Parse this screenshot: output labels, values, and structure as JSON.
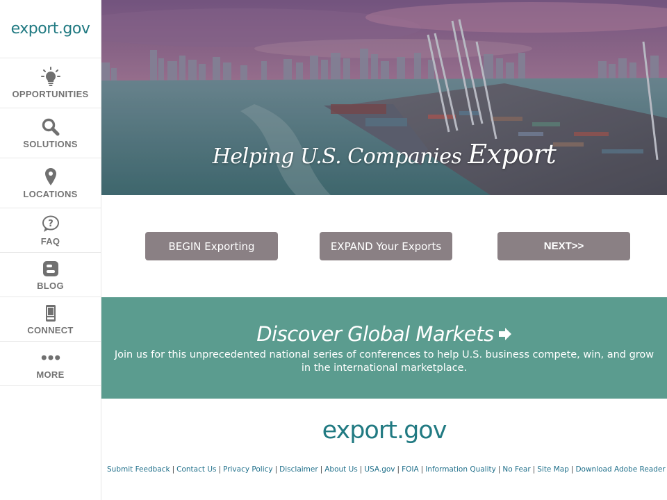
{
  "sidebar": {
    "logo": "export.gov",
    "items": [
      {
        "label": "OPPORTUNITIES",
        "icon": "lightbulb-icon"
      },
      {
        "label": "SOLUTIONS",
        "icon": "search-icon"
      },
      {
        "label": "LOCATIONS",
        "icon": "map-pin-icon"
      },
      {
        "label": "FAQ",
        "icon": "question-bubble-icon"
      },
      {
        "label": "BLOG",
        "icon": "blogger-icon"
      },
      {
        "label": "CONNECT",
        "icon": "mobile-phone-icon"
      },
      {
        "label": "MORE",
        "icon": "more-dots-icon"
      }
    ]
  },
  "hero": {
    "title_prefix": "Helping U.S. Companies ",
    "title_emphasis": "Export"
  },
  "buttons": {
    "begin": "BEGIN Exporting",
    "expand": "EXPAND Your Exports",
    "next": "NEXT>>"
  },
  "banner": {
    "title": "Discover Global Markets",
    "text": "Join us for this unprecedented national series of conferences to help U.S. business compete, win, and grow in the international marketplace.",
    "icon": "arrow-right-icon"
  },
  "footer": {
    "logo": "export.gov",
    "links": [
      "Submit Feedback",
      "Contact Us",
      "Privacy Policy",
      "Disclaimer",
      "About Us",
      "USA.gov",
      "FOIA",
      "Information Quality",
      "No Fear",
      "Site Map",
      "Download Adobe Reader"
    ]
  },
  "colors": {
    "brand_teal": "#217a82",
    "banner_green": "#5b9c8f",
    "button_gray": "#8a8084",
    "nav_label_gray": "#737373"
  }
}
